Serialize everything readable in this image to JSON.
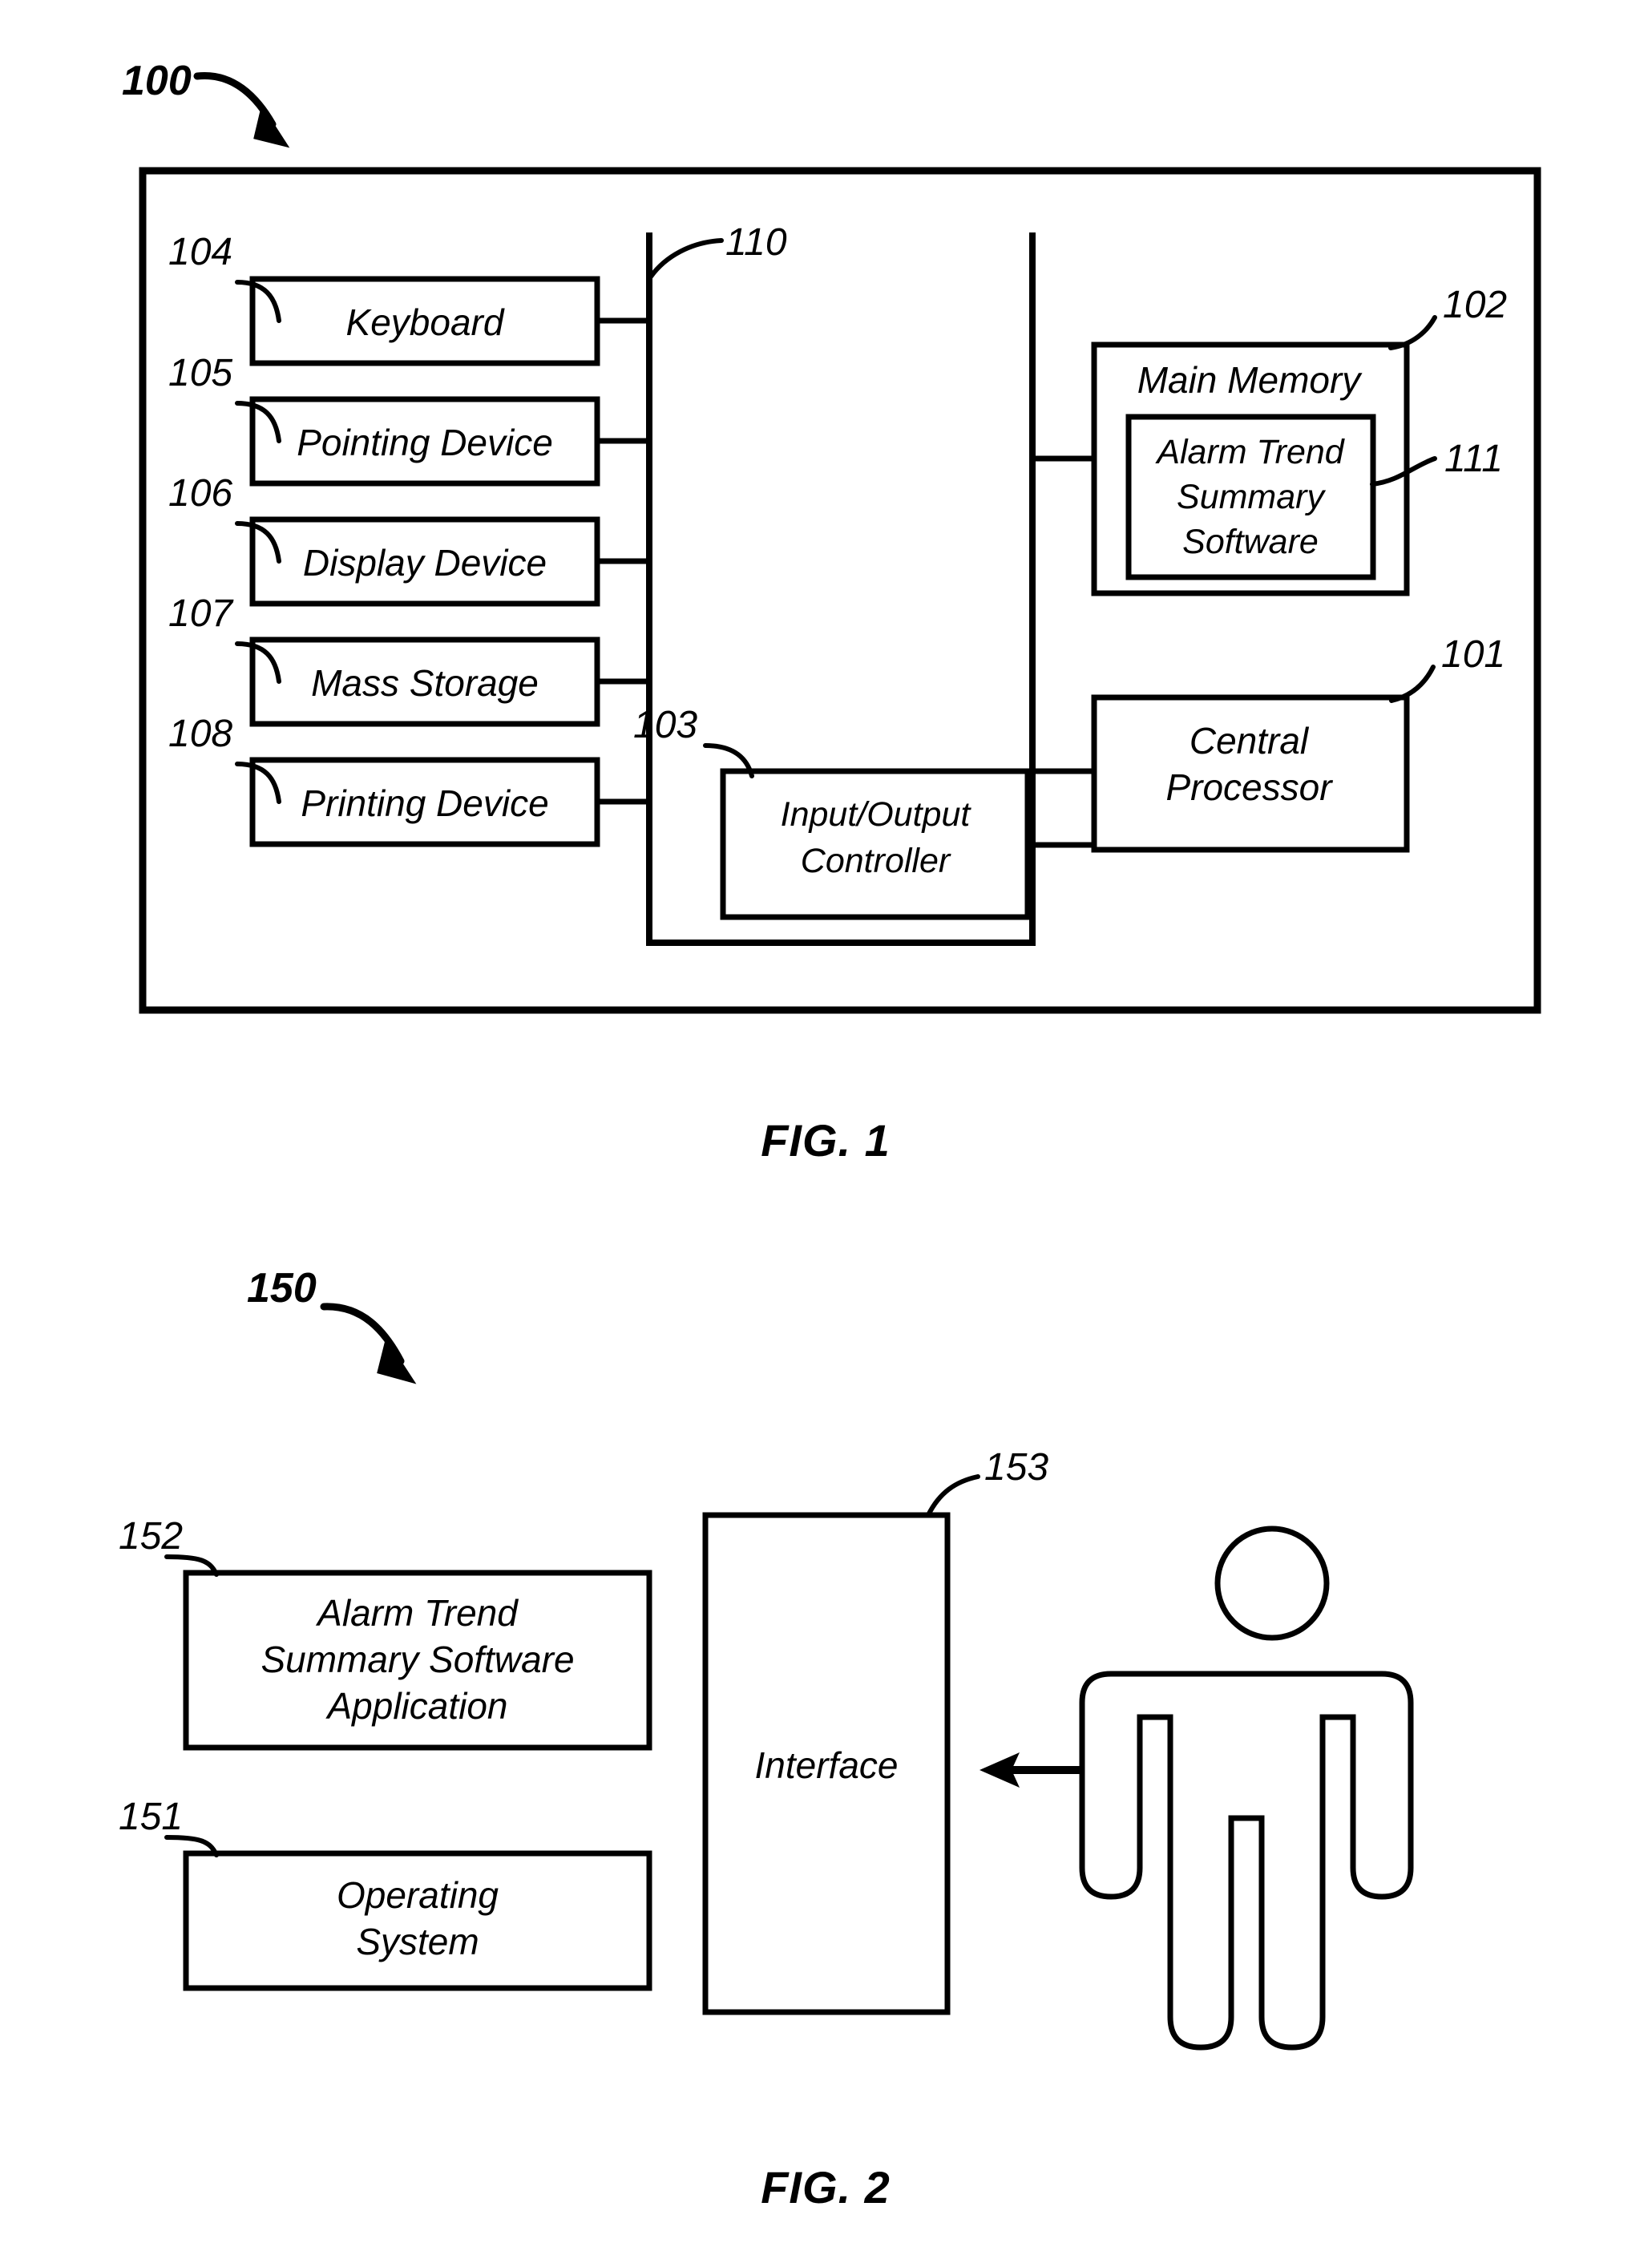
{
  "document": {
    "type": "patent-drawing-sheet",
    "background_color": "#ffffff",
    "line_color": "#000000"
  },
  "figure1": {
    "caption": "FIG. 1",
    "system_ref": "100",
    "outer_frame_label": "computer-system-frame",
    "bus_ref": "110",
    "peripherals": [
      {
        "ref": "104",
        "label": "Keyboard"
      },
      {
        "ref": "105",
        "label": "Pointing Device"
      },
      {
        "ref": "106",
        "label": "Display Device"
      },
      {
        "ref": "107",
        "label": "Mass Storage"
      },
      {
        "ref": "108",
        "label": "Printing Device"
      }
    ],
    "io_controller": {
      "ref": "103",
      "line1": "Input/Output",
      "line2": "Controller"
    },
    "main_memory": {
      "ref": "102",
      "label": "Main Memory"
    },
    "alarm_software": {
      "ref": "111",
      "line1": "Alarm Trend",
      "line2": "Summary",
      "line3": "Software"
    },
    "central_processor": {
      "ref": "101",
      "line1": "Central",
      "line2": "Processor"
    }
  },
  "figure2": {
    "caption": "FIG. 2",
    "system_ref": "150",
    "application": {
      "ref": "152",
      "line1": "Alarm Trend",
      "line2": "Summary Software",
      "line3": "Application"
    },
    "operating_system": {
      "ref": "151",
      "line1": "Operating",
      "line2": "System"
    },
    "interface": {
      "ref": "153",
      "label": "Interface"
    },
    "user": {
      "icon": "person-icon",
      "label": "user-figure"
    },
    "connector": {
      "icon": "double-arrow-icon"
    }
  }
}
